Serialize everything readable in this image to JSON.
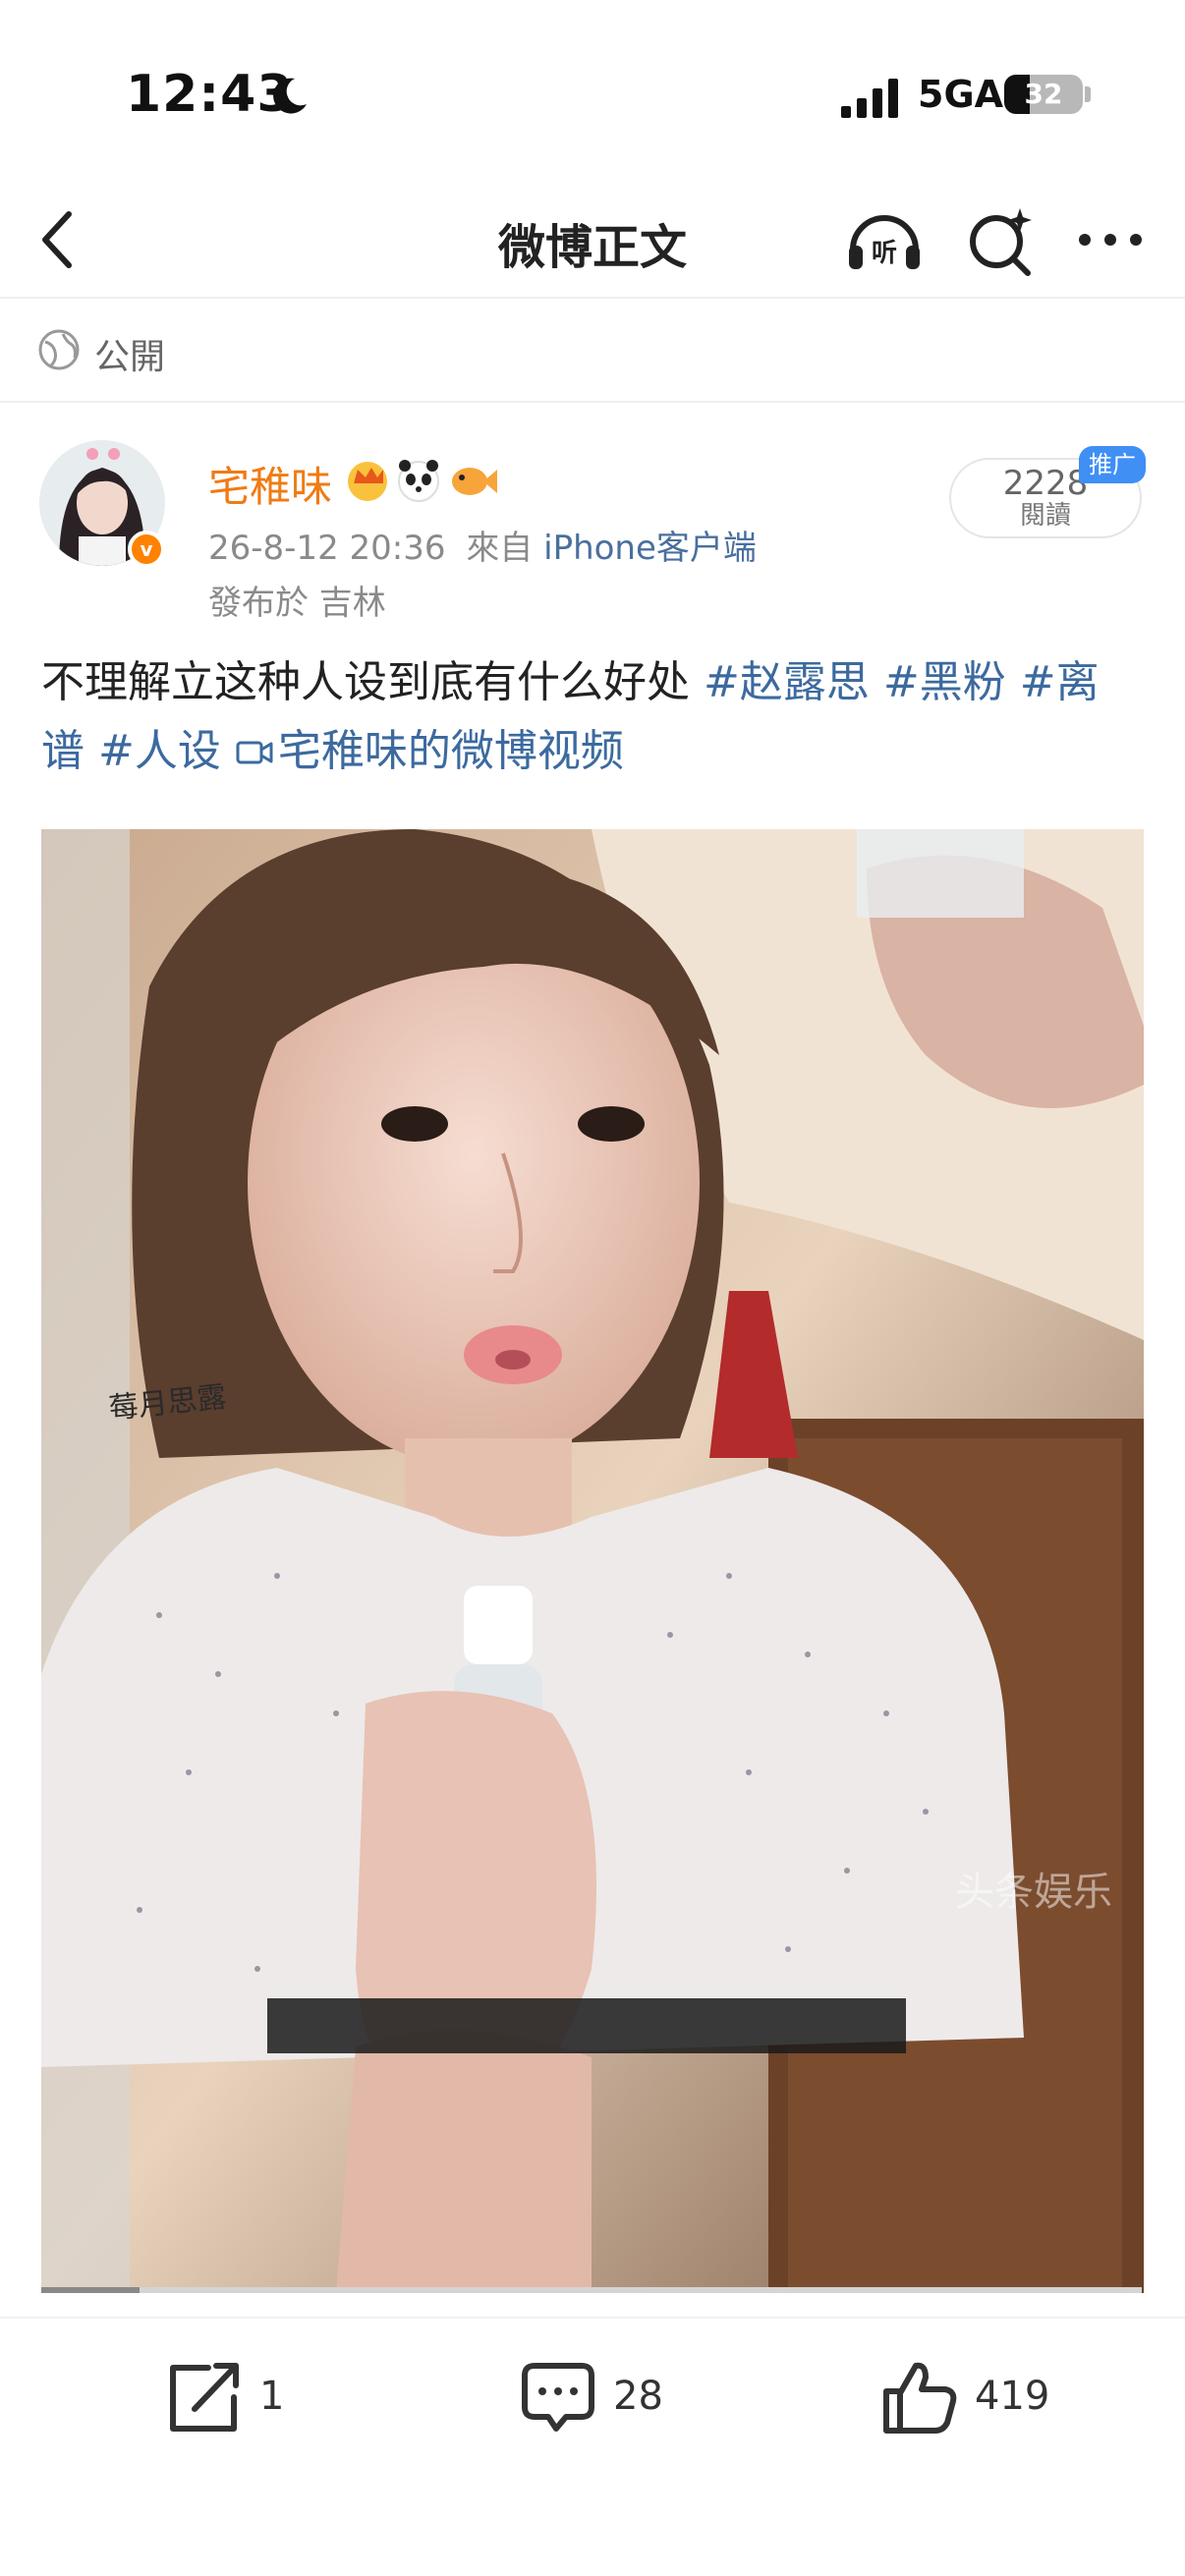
{
  "status_bar": {
    "time": "12:43",
    "network": "5GA",
    "battery": "32"
  },
  "nav": {
    "title": "微博正文"
  },
  "visibility": {
    "label": "公開"
  },
  "post": {
    "user_name": "宅稚味",
    "date": "26-8-12 20:36",
    "source_prefix": "來自",
    "source_device": "iPhone客户端",
    "location": "發布於 吉林",
    "reads_count": "2228",
    "reads_label": "閱讀",
    "promo_badge": "推广",
    "text": "不理解立这种人设到底有什么好处 ",
    "tags": [
      "#赵露思",
      "#黑粉",
      "#离谱",
      "#人设"
    ],
    "video_link": "宅稚味的微博视频",
    "media": {
      "watermark_left": "莓月思露",
      "watermark_right": "头条娱乐"
    }
  },
  "actions": {
    "share_count": "1",
    "comment_count": "28",
    "like_count": "419"
  },
  "colors": {
    "accent_orange": "#f07b14",
    "link_blue": "#3c6a9f",
    "promo_blue": "#3f8ff5"
  },
  "icons": [
    "moon-icon",
    "signal-icon",
    "back-icon",
    "listen-icon",
    "search-icon",
    "more-icon",
    "globe-icon",
    "video-icon",
    "share-icon",
    "comment-icon",
    "like-icon"
  ]
}
